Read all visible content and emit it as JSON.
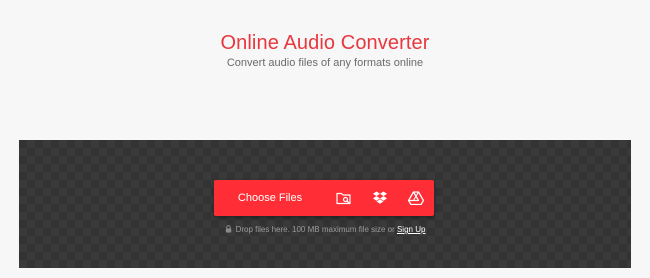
{
  "header": {
    "title": "Online Audio Converter",
    "subtitle": "Convert audio files of any formats online"
  },
  "uploader": {
    "choose_label": "Choose Files",
    "buttons": [
      {
        "icon": "folder-search-icon",
        "purpose": "browse-device"
      },
      {
        "icon": "dropbox-icon",
        "purpose": "dropbox"
      },
      {
        "icon": "google-drive-icon",
        "purpose": "google-drive"
      }
    ],
    "hint_text": "Drop files here. 100 MB maximum file size or",
    "signup_link": "Sign Up"
  },
  "colors": {
    "accent": "#ff2d35",
    "title": "#e8373e",
    "dropzone_bg": "#333333",
    "page_bg": "#f7f7f7"
  }
}
